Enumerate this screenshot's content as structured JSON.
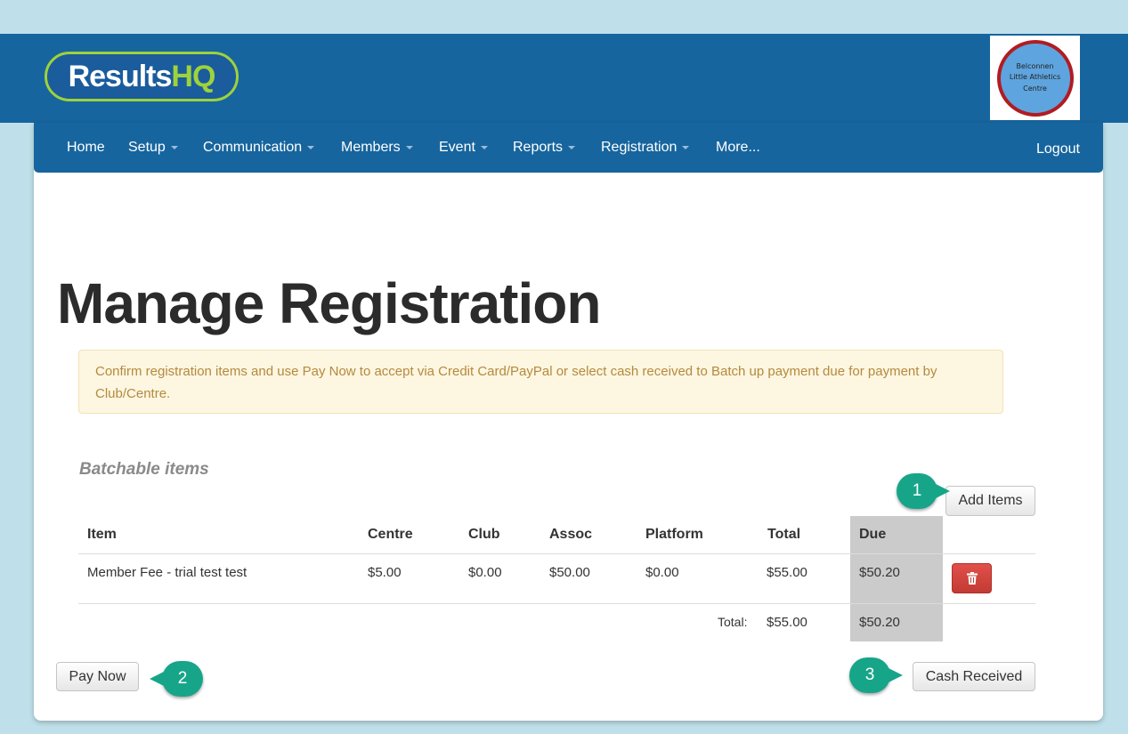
{
  "header": {
    "logo": {
      "main": "Results",
      "accent": "HQ"
    },
    "club_logo": {
      "line1": "Belconnen",
      "line2": "Little Athletics",
      "line3": "Centre"
    }
  },
  "nav": {
    "items": [
      "Home",
      "Setup",
      "Communication",
      "Members",
      "Event",
      "Reports",
      "Registration",
      "More..."
    ],
    "logout": "Logout"
  },
  "page": {
    "title": "Manage Registration",
    "alert": "Confirm registration items and use Pay Now to accept via Credit Card/PayPal or select cash received to Batch up payment due for payment by Club/Centre.",
    "section_title": "Batchable items",
    "add_items": "Add Items"
  },
  "table": {
    "headers": [
      "Item",
      "Centre",
      "Club",
      "Assoc",
      "Platform",
      "Total",
      "Due"
    ],
    "rows": [
      [
        "Member Fee - trial test test",
        "$5.00",
        "$0.00",
        "$50.00",
        "$0.00",
        "$55.00",
        "$50.20"
      ]
    ],
    "total_label": "Total:",
    "total_total": "$55.00",
    "total_due": "$50.20"
  },
  "actions": {
    "pay_now": "Pay Now",
    "cash_received": "Cash Received"
  },
  "callouts": [
    "1",
    "2",
    "3"
  ],
  "colors": {
    "nav": "#17659e",
    "accent": "#17a589",
    "delete": "#d9534f",
    "alert_bg": "#fdf6e1"
  }
}
